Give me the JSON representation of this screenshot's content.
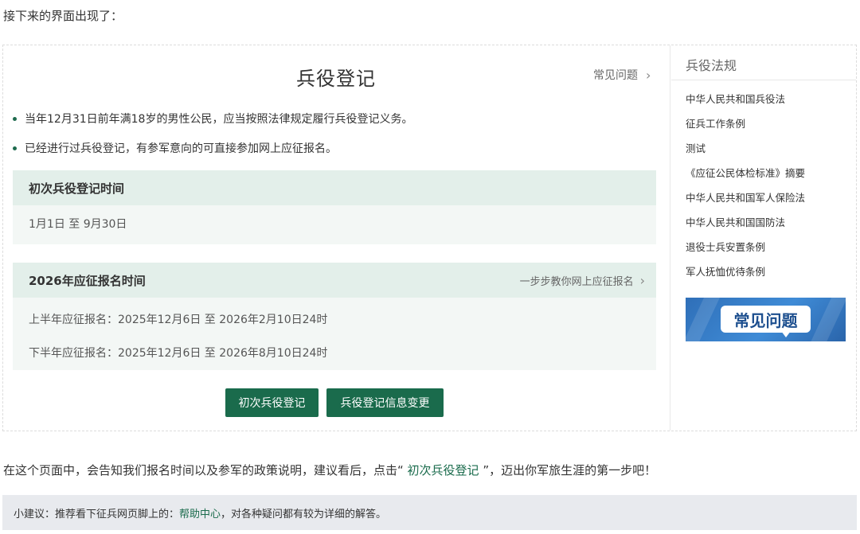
{
  "article": {
    "intro": "接下来的界面出现了：",
    "outro_before": "在这个页面中，会告知我们报名时间以及参军的政策说明，建议看后，点击“",
    "outro_link": " 初次兵役登记 ",
    "outro_after": "”，迈出你军旅生涯的第一步吧！",
    "tip_before": "小建议：推荐看下征兵网页脚上的：",
    "tip_link": " 帮助中心 ",
    "tip_after": "，对各种疑问都有较为详细的解答。"
  },
  "page": {
    "title": "兵役登记",
    "faq_link": "常见问题",
    "bullets": [
      "当年12月31日前年满18岁的男性公民，应当按照法律规定履行兵役登记义务。",
      "已经进行过兵役登记，有参军意向的可直接参加网上应征报名。"
    ],
    "card1": {
      "title": "初次兵役登记时间",
      "row": "1月1日 至 9月30日"
    },
    "card2": {
      "title": "2026年应征报名时间",
      "link": "一步步教你网上应征报名",
      "row1": "上半年应征报名：2025年12月6日 至 2026年2月10日24时",
      "row2": "下半年应征报名：2025年12月6日 至 2026年8月10日24时"
    },
    "buttons": {
      "register": "初次兵役登记",
      "change": "兵役登记信息变更"
    }
  },
  "sidebar": {
    "title": "兵役法规",
    "laws": [
      "中华人民共和国兵役法",
      "征兵工作条例",
      "测试",
      "《应征公民体检标准》摘要",
      "中华人民共和国军人保险法",
      "中华人民共和国国防法",
      "退役士兵安置条例",
      "军人抚恤优待条例"
    ],
    "banner_text": "常见问题"
  },
  "colors": {
    "brand_green": "#1a6b4c",
    "card_header": "#e3efea",
    "card_body": "#f3f7f5",
    "banner_blue": "#3f8bd6",
    "tip_bg": "#e8eaee"
  },
  "icons": [
    "chevron-right-icon",
    "bullet-dot-icon"
  ]
}
